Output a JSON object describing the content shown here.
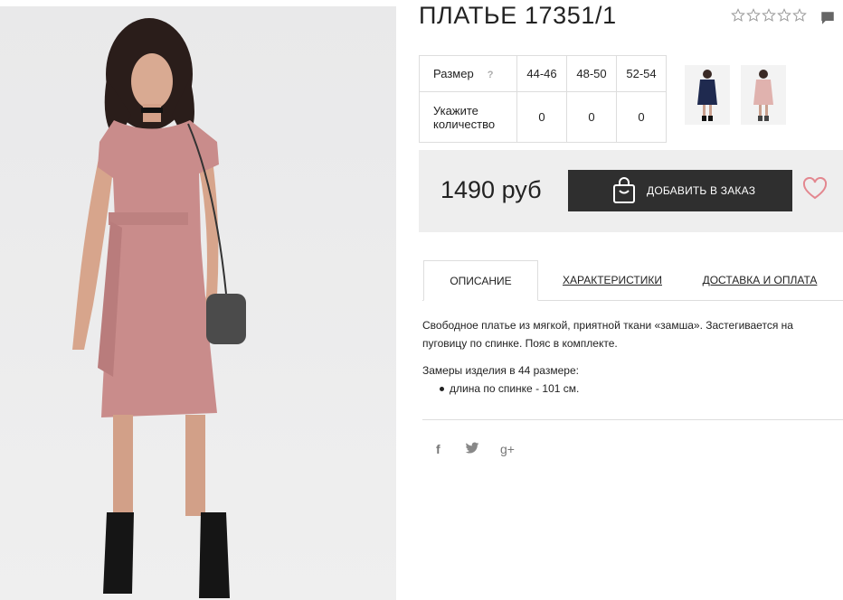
{
  "product": {
    "title": "ПЛАТЬЕ 17351/1",
    "price": "1490 руб"
  },
  "rating": {
    "stars": 0,
    "max": 5
  },
  "sizes": {
    "size_label": "Размер",
    "help": "?",
    "qty_label_line1": "Укажите",
    "qty_label_line2": "количество",
    "values": [
      "44-46",
      "48-50",
      "52-54"
    ],
    "quantities": [
      "0",
      "0",
      "0"
    ]
  },
  "thumbnails": [
    "navy-dress-thumb",
    "pink-dress-thumb"
  ],
  "actions": {
    "add_to_order": "ДОБАВИТЬ В ЗАКАЗ"
  },
  "tabs": [
    "ОПИСАНИЕ",
    "ХАРАКТЕРИСТИКИ",
    "ДОСТАВКА И ОПЛАТА"
  ],
  "description": {
    "text": "Свободное платье из мягкой, приятной ткани «замша». Застегивается на пуговицу по спинке. Пояс в комплекте.",
    "measure_title": "Замеры изделия в 44 размере:",
    "measure_item": "длина по спинке - 101 см."
  },
  "social": {
    "facebook": "f",
    "twitter": "🐦",
    "google": "g+"
  },
  "colors": {
    "dark_button": "#2f2f2f",
    "heart": "#e3878f",
    "price_box": "#eeeeee"
  }
}
